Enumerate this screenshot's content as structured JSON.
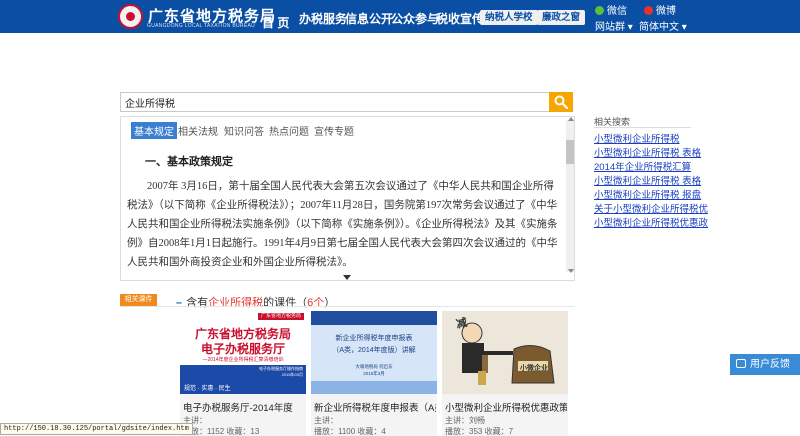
{
  "header": {
    "site_title": "广东省地方税务局",
    "site_subtitle": "GUANGDONG LOCAL TAXATION BUREAU",
    "nav": [
      "首 页",
      "办税服务",
      "信息公开",
      "公众参与",
      "税收宣传"
    ],
    "pills": [
      "纳税人学校",
      "廉政之窗"
    ],
    "social": [
      "微信",
      "微博"
    ],
    "links": [
      "网站群",
      "简体中文"
    ],
    "colors": {
      "bar": "#0a4fa3",
      "accent": "#f5a600"
    }
  },
  "search": {
    "value": "企业所得税"
  },
  "result": {
    "tabs": [
      "基本规定",
      "相关法规",
      "知识问答",
      "热点问题",
      "宣传专题"
    ],
    "section_title": "一、基本政策规定",
    "paragraph": "2007年 3月16日，第十届全国人民代表大会第五次会议通过了《中华人民共和国企业所得税法》（以下简称《企业所得税法》）；2007年11月28日，国务院第197次常务会议通过了《中华人民共和国企业所得税法实施条例》（以下简称《实施条例》）。《企业所得税法》及其《实施条例》自2008年1月1日起施行。1991年4月9日第七届全国人民代表大会第四次会议通过的《中华人民共和国外商投资企业和外国企业所得税法》。"
  },
  "related": {
    "title": "相关搜索",
    "links": [
      "小型微利企业所得税",
      "小型微利企业所得税 表格",
      "2014年企业所得税汇算",
      "小型微利企业所得税 表格",
      "小型微利企业所得税 报盘",
      "关于小型微利企业所得税优",
      "小型微利企业所得税优惠政"
    ]
  },
  "courses": {
    "tag": "相关课件",
    "prefix": "含有",
    "keyword": "企业所得税",
    "suffix": "的课件（",
    "count": "6个",
    "close": "）",
    "items": [
      {
        "title": "电子办税服务厅-2014年度",
        "lecturer": "主讲：",
        "stats": "播放：1152 收藏：13",
        "thumb": {
          "header": "广东省地方税务局",
          "line1": "广东省地方税务局",
          "line2": "电子办税服务厅",
          "line3": "—2014年度企业所得税汇算清缴培训",
          "line4": "电子办税服务厅操作指南",
          "line5": "2015年03月",
          "footer": "规范 · 实惠 · 民生"
        }
      },
      {
        "title": "新企业所得税年度申报表（A类",
        "lecturer": "主讲：",
        "stats": "播放：1100 收藏：4",
        "thumb": {
          "line1": "新企业所得税年度申报表",
          "line2": "（A类，2014年度版）讲解",
          "line3": "大埔地税局 何启东",
          "line4": "2015年3月"
        }
      },
      {
        "title": "小型微利企业所得税优惠政策讲",
        "lecturer": "主讲：刘畅",
        "stats": "播放：353 收藏：7",
        "thumb": {
          "label1": "减",
          "label2": "小微企业"
        }
      }
    ]
  },
  "feedback": "用户反馈",
  "status_url": "http://150.18.30.125/portal/gdsite/index.htm"
}
